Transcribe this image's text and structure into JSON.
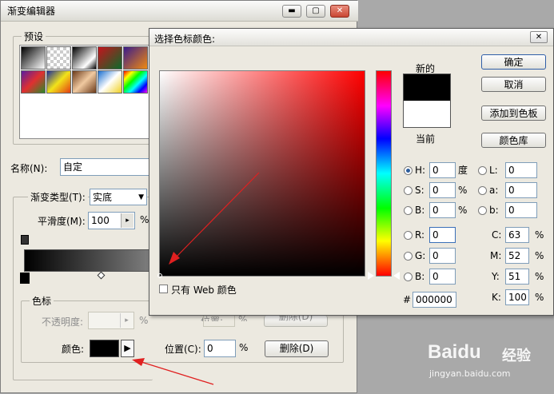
{
  "gradient_editor": {
    "title": "渐变编辑器",
    "presets_label": "预设",
    "name_label": "名称(N):",
    "name_value": "自定",
    "gradient_type_label": "渐变类型(T):",
    "gradient_type_value": "实底",
    "smoothness_label": "平滑度(M):",
    "smoothness_value": "100",
    "smoothness_unit": "%",
    "stops_group_label": "色标",
    "opacity_label": "不透明度:",
    "opacity_unit": "%",
    "position_label_dim": "位置:",
    "position_unit_dim": "%",
    "delete_label_dim": "删除(D)",
    "color_label": "颜色:",
    "position_label": "位置(C):",
    "position_value": "0",
    "position_unit": "%",
    "delete_label": "删除(D)",
    "title_buttons": [
      "▬",
      "▢",
      "✕"
    ]
  },
  "color_picker": {
    "title": "选择色标颜色:",
    "close_glyph": "✕",
    "new_label": "新的",
    "current_label": "当前",
    "new_color": "#000000",
    "current_color": "#ffffff",
    "buttons": {
      "ok": "确定",
      "cancel": "取消",
      "add_to_swatches": "添加到色板",
      "color_libraries": "颜色库"
    },
    "web_only_label": "只有 Web 颜色",
    "hsb": [
      {
        "label": "H:",
        "value": "0",
        "unit": "度",
        "selected": true
      },
      {
        "label": "S:",
        "value": "0",
        "unit": "%",
        "selected": false
      },
      {
        "label": "B:",
        "value": "0",
        "unit": "%",
        "selected": false
      }
    ],
    "rgb": [
      {
        "label": "R:",
        "value": "0"
      },
      {
        "label": "G:",
        "value": "0"
      },
      {
        "label": "B:",
        "value": "0"
      }
    ],
    "lab": [
      {
        "label": "L:",
        "value": "0"
      },
      {
        "label": "a:",
        "value": "0"
      },
      {
        "label": "b:",
        "value": "0"
      }
    ],
    "cmyk": [
      {
        "label": "C:",
        "value": "63",
        "unit": "%"
      },
      {
        "label": "M:",
        "value": "52",
        "unit": "%"
      },
      {
        "label": "Y:",
        "value": "51",
        "unit": "%"
      },
      {
        "label": "K:",
        "value": "100",
        "unit": "%"
      }
    ],
    "hex_label": "#",
    "hex_value": "000000"
  },
  "watermark": {
    "brand": "Baidu",
    "brand_cn": "经验",
    "url": "jingyan.baidu.com"
  },
  "colors": {
    "annotation_arrow": "#e02020",
    "hue_marker_selected": "red"
  }
}
